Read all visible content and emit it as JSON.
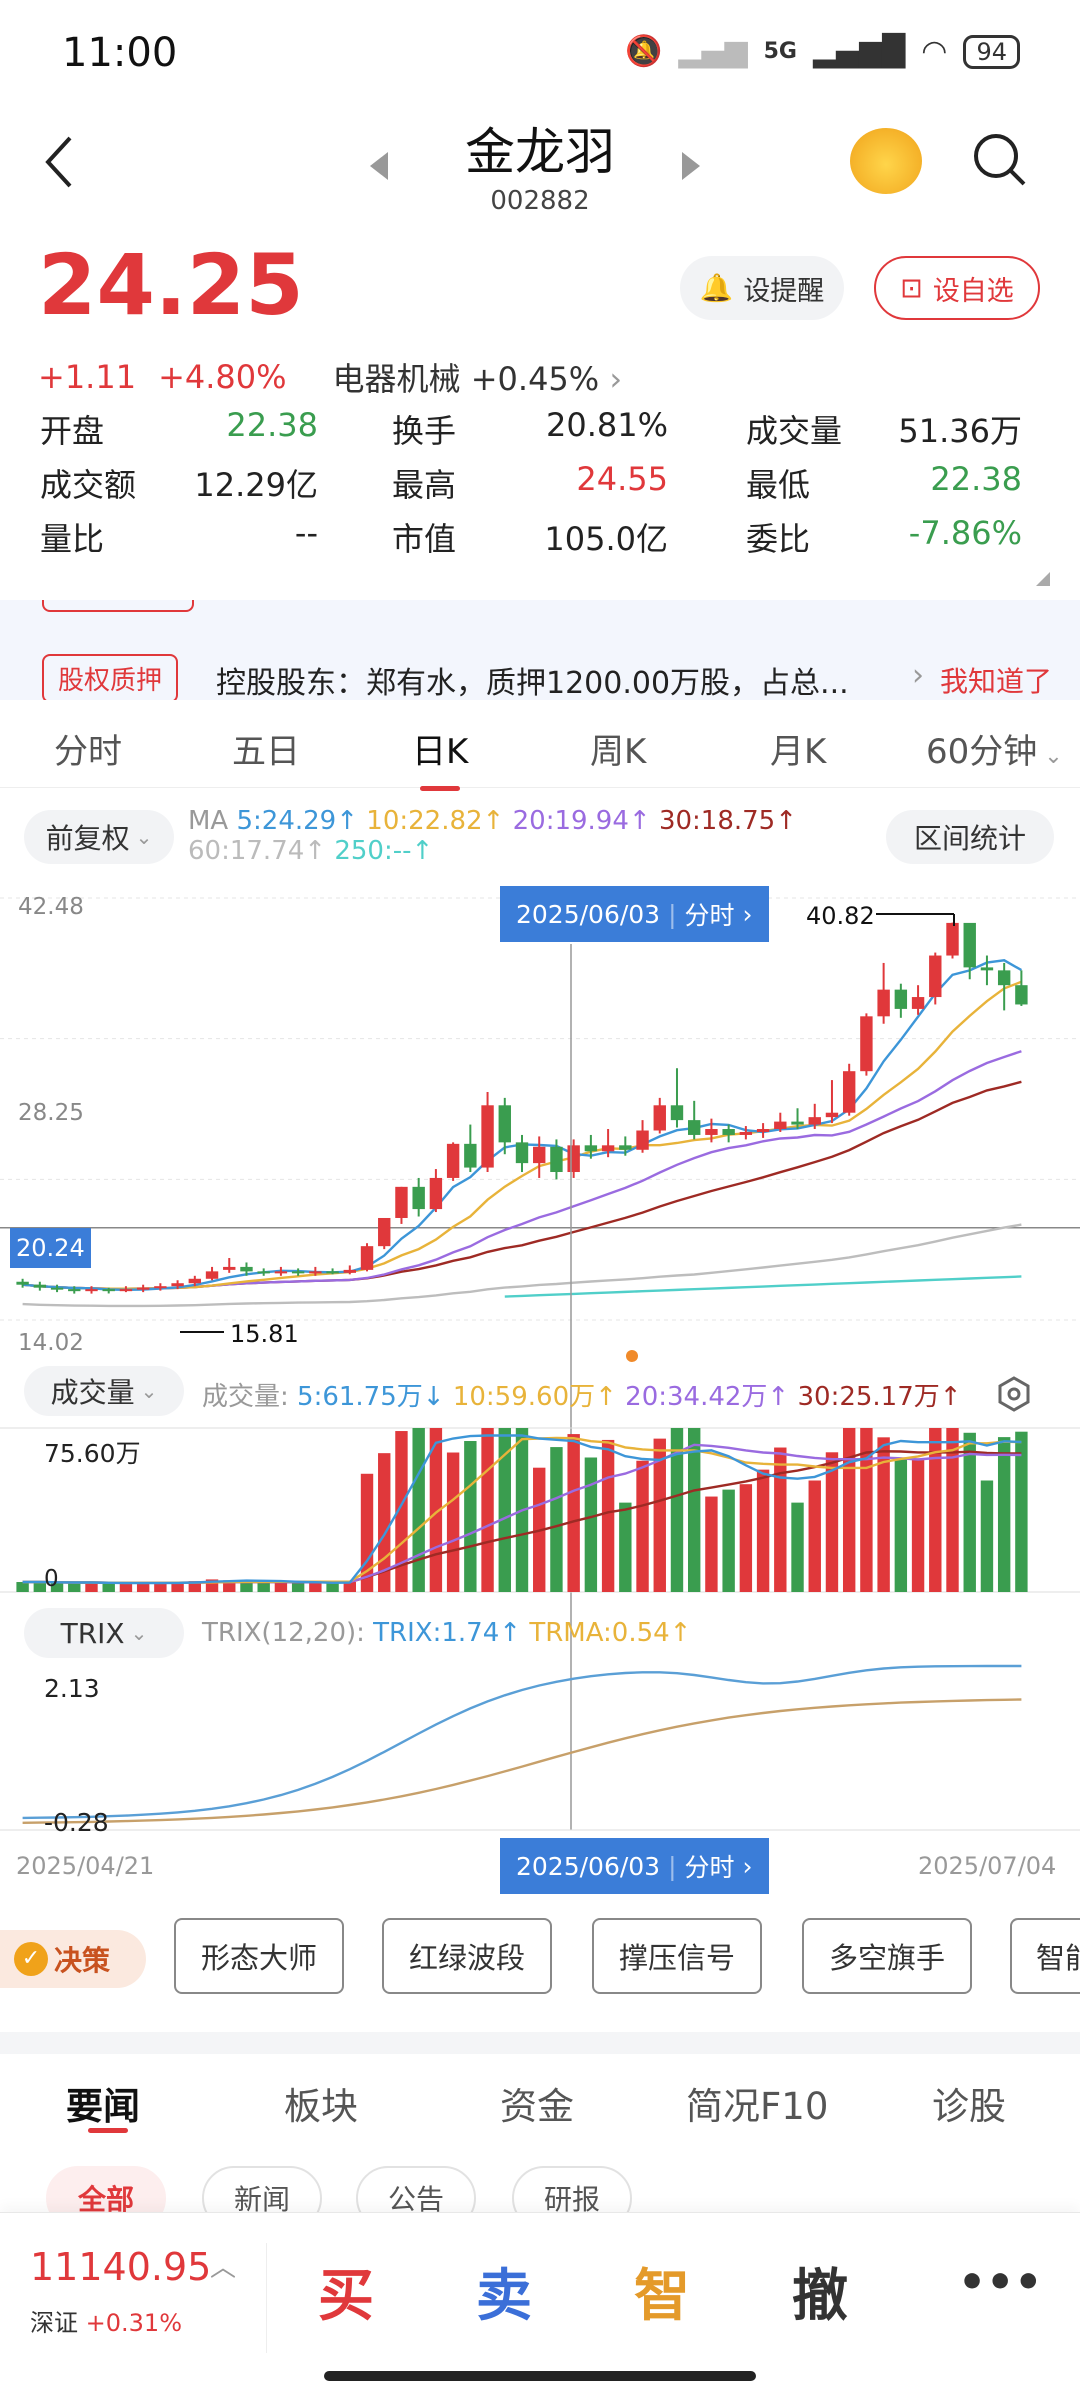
{
  "status": {
    "time": "11:00",
    "network": "5G",
    "battery": "94"
  },
  "header": {
    "title": "金龙羽",
    "code": "002882"
  },
  "quote": {
    "price": "24.25",
    "change": "+1.11",
    "change_pct": "+4.80%",
    "sector_name": "电器机械",
    "sector_pct": "+0.45%",
    "alert_btn": "设提醒",
    "watch_btn": "设自选",
    "stats": [
      {
        "label": "开盘",
        "value": "22.38",
        "color": "green"
      },
      {
        "label": "换手",
        "value": "20.81%",
        "color": "black"
      },
      {
        "label": "成交量",
        "value": "51.36万",
        "color": "black"
      },
      {
        "label": "成交额",
        "value": "12.29亿",
        "color": "black"
      },
      {
        "label": "最高",
        "value": "24.55",
        "color": "red"
      },
      {
        "label": "最低",
        "value": "22.38",
        "color": "green"
      },
      {
        "label": "量比",
        "value": "--",
        "color": "black"
      },
      {
        "label": "市值",
        "value": "105.0亿",
        "color": "black"
      },
      {
        "label": "委比",
        "value": "-7.86%",
        "color": "green"
      }
    ]
  },
  "notice": {
    "tag": "股权质押",
    "text": "控股股东：郑有水，质押1200.00万股，占总...",
    "action": "我知道了"
  },
  "tabs": [
    "分时",
    "五日",
    "日K",
    "周K",
    "月K",
    "60分钟"
  ],
  "active_tab": "日K",
  "chart_controls": {
    "adjust": "前复权",
    "range_stats": "区间统计",
    "volume_label": "成交量",
    "indicator_label": "TRIX"
  },
  "ma_legend": {
    "prefix": "MA",
    "ma5": "5:24.29↑",
    "ma10": "10:22.82↑",
    "ma20": "20:19.94↑",
    "ma30": "30:18.75↑",
    "ma60": "60:17.74↑",
    "ma250": "250:--↑"
  },
  "vol_legend": {
    "prefix": "成交量:",
    "v5": "5:61.75万↓",
    "v10": "10:59.60万↑",
    "v20": "20:34.42万↑",
    "v30": "30:25.17万↑"
  },
  "trix_legend": {
    "prefix": "TRIX(12,20):",
    "trix": "TRIX:1.74↑",
    "trma": "TRMA:0.54↑"
  },
  "axes": {
    "price_top": "42.48",
    "price_mid": "28.25",
    "price_bottom": "14.02",
    "current": "20.24",
    "max_label": "40.82",
    "min_label": "15.81",
    "vol_top": "75.60万",
    "vol_zero": "0",
    "trix_top": "2.13",
    "trix_bottom": "-0.28",
    "date_start": "2025/04/21",
    "date_end": "2025/07/04",
    "cursor_date": "2025/06/03",
    "cursor_action": "分时"
  },
  "colors": {
    "up": "#e0383b",
    "down": "#3a9d4f",
    "ma5": "#3d96d8",
    "ma10": "#e8b33a",
    "ma20": "#9a6be0",
    "ma30": "#9e2a24",
    "ma60": "#bdbdbd",
    "ma250": "#50cfc9",
    "accent": "#e0383b"
  },
  "chart_data": {
    "type": "candlestick",
    "ylim": [
      14.02,
      42.48
    ],
    "candles": [
      [
        16.6,
        16.4,
        16.8,
        16.2
      ],
      [
        16.4,
        16.2,
        16.6,
        16.0
      ],
      [
        16.2,
        16.1,
        16.4,
        15.9
      ],
      [
        16.1,
        16.0,
        16.3,
        15.8
      ],
      [
        16.0,
        16.1,
        16.3,
        15.8
      ],
      [
        16.1,
        16.0,
        16.2,
        15.81
      ],
      [
        16.0,
        16.1,
        16.3,
        15.9
      ],
      [
        16.1,
        16.2,
        16.4,
        15.9
      ],
      [
        16.2,
        16.3,
        16.5,
        16.0
      ],
      [
        16.3,
        16.5,
        16.7,
        16.1
      ],
      [
        16.5,
        16.8,
        17.0,
        16.3
      ],
      [
        16.8,
        17.3,
        17.6,
        16.7
      ],
      [
        17.4,
        17.6,
        18.2,
        17.2
      ],
      [
        17.6,
        17.3,
        17.9,
        17.0
      ],
      [
        17.3,
        17.2,
        17.5,
        17.0
      ],
      [
        17.2,
        17.3,
        17.6,
        17.0
      ],
      [
        17.3,
        17.2,
        17.5,
        17.0
      ],
      [
        17.2,
        17.3,
        17.6,
        17.0
      ],
      [
        17.3,
        17.2,
        17.5,
        17.1
      ],
      [
        17.2,
        17.4,
        17.7,
        17.1
      ],
      [
        17.4,
        19.0,
        19.2,
        17.3
      ],
      [
        19.0,
        20.9,
        20.9,
        18.8
      ],
      [
        20.9,
        23.0,
        23.0,
        20.5
      ],
      [
        23.0,
        21.5,
        23.6,
        21.0
      ],
      [
        21.5,
        23.6,
        24.2,
        21.3
      ],
      [
        23.6,
        25.9,
        26.0,
        23.4
      ],
      [
        25.9,
        24.3,
        27.2,
        24.0
      ],
      [
        24.3,
        28.5,
        29.4,
        24.0
      ],
      [
        28.5,
        26.0,
        29.0,
        25.2
      ],
      [
        26.0,
        24.6,
        26.5,
        24.0
      ],
      [
        24.6,
        25.7,
        26.4,
        23.6
      ],
      [
        25.7,
        24.0,
        26.2,
        23.5
      ],
      [
        24.0,
        25.8,
        26.2,
        23.6
      ],
      [
        25.8,
        25.4,
        26.5,
        24.9
      ],
      [
        25.4,
        25.8,
        26.9,
        25.0
      ],
      [
        25.8,
        25.5,
        26.4,
        25.1
      ],
      [
        25.5,
        26.8,
        27.5,
        25.3
      ],
      [
        26.8,
        28.5,
        29.0,
        26.6
      ],
      [
        28.5,
        27.5,
        31.0,
        27.0
      ],
      [
        27.5,
        26.5,
        28.8,
        26.2
      ],
      [
        26.5,
        26.9,
        27.6,
        26.0
      ],
      [
        26.9,
        26.5,
        27.2,
        26.0
      ],
      [
        26.5,
        26.7,
        27.1,
        26.2
      ],
      [
        26.7,
        26.9,
        27.3,
        26.3
      ],
      [
        26.9,
        27.4,
        28.0,
        26.7
      ],
      [
        27.4,
        27.2,
        28.3,
        26.9
      ],
      [
        27.2,
        27.7,
        28.6,
        26.9
      ],
      [
        27.7,
        28.0,
        30.2,
        27.3
      ],
      [
        28.0,
        30.8,
        31.3,
        27.8
      ],
      [
        30.8,
        34.5,
        34.7,
        30.5
      ],
      [
        34.5,
        36.3,
        38.1,
        34.0
      ],
      [
        36.3,
        35.0,
        36.7,
        34.4
      ],
      [
        35.0,
        35.8,
        36.6,
        34.6
      ],
      [
        35.8,
        38.6,
        38.8,
        35.3
      ],
      [
        38.6,
        40.8,
        40.82,
        38.4
      ],
      [
        40.8,
        37.8,
        40.2,
        37.0
      ],
      [
        37.8,
        37.6,
        38.6,
        36.6
      ],
      [
        37.6,
        36.6,
        38.1,
        34.9
      ],
      [
        36.6,
        35.3,
        37.6,
        35.2
      ]
    ],
    "volume_ylim": [
      0,
      75.6
    ]
  }
}
